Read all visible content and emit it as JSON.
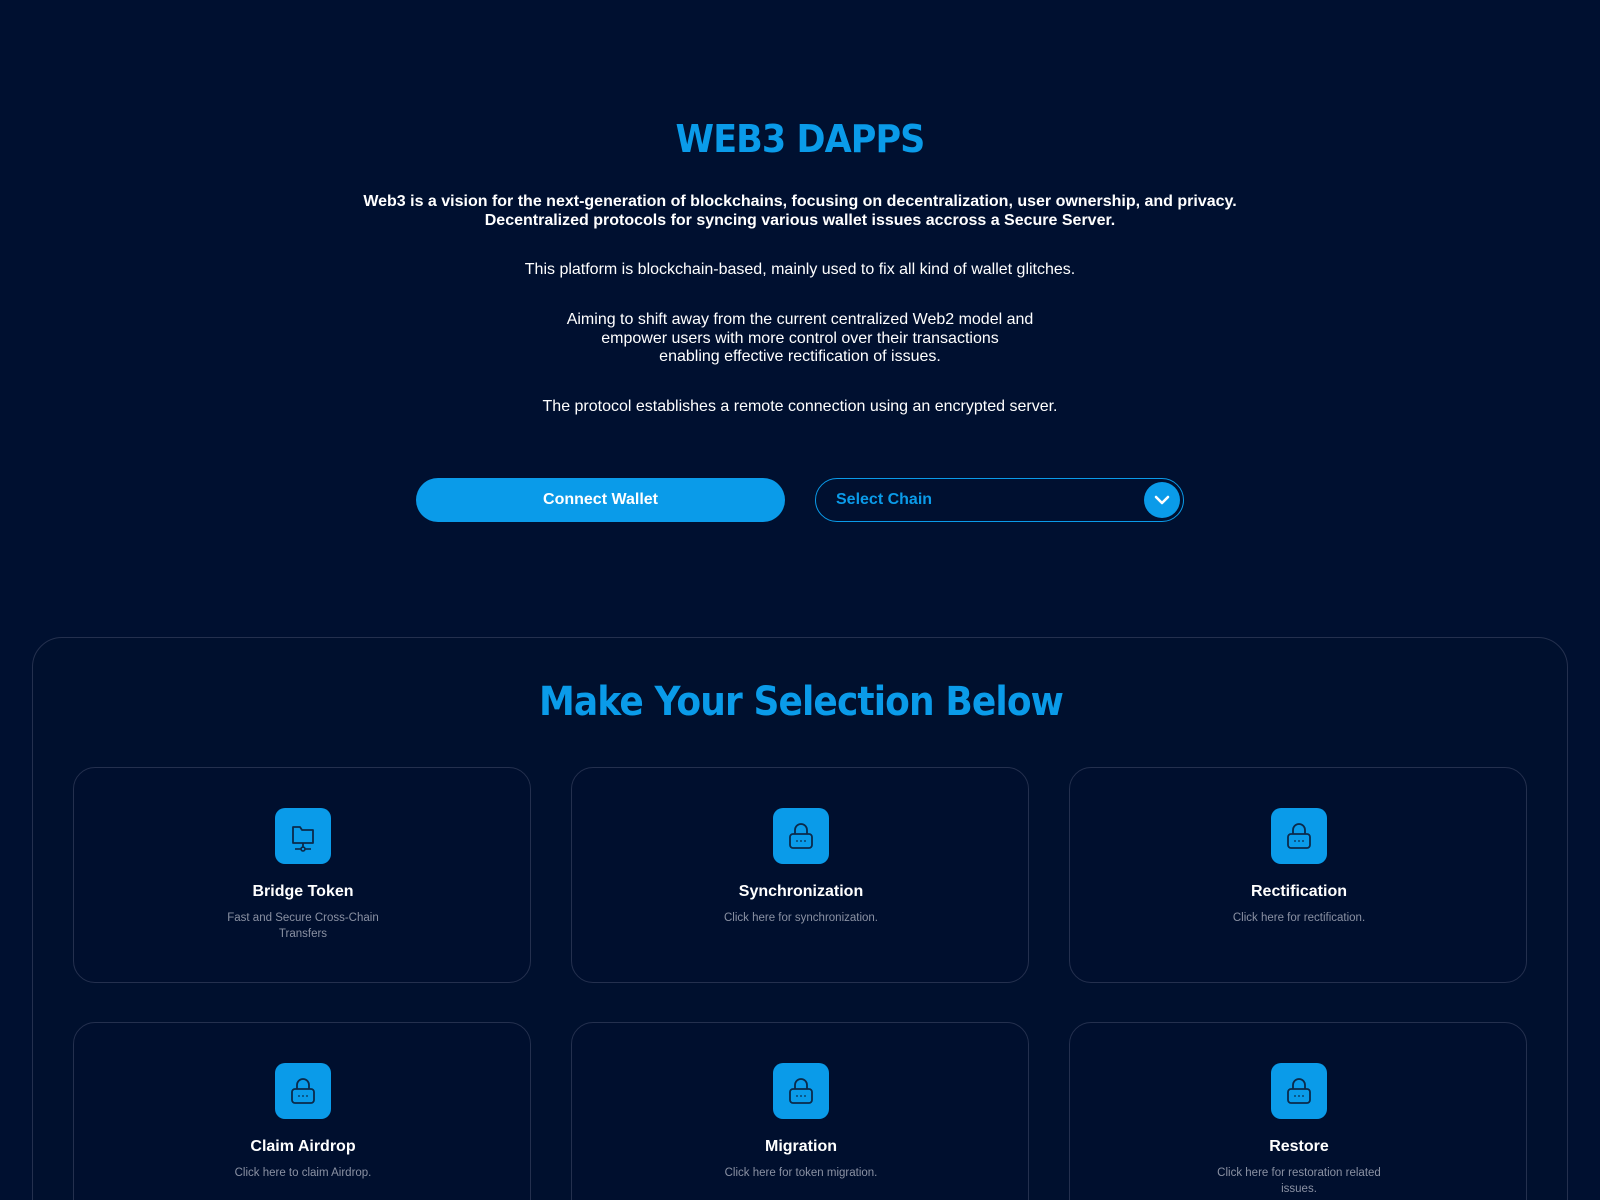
{
  "hero": {
    "title": "WEB3 DAPPS",
    "lead_line1": "Web3 is a vision for the next-generation of blockchains, focusing on decentralization, user ownership, and privacy.",
    "lead_line2": "Decentralized protocols for syncing various wallet issues accross a Secure Server.",
    "paragraph1": "This platform is blockchain-based, mainly used to fix all kind of wallet glitches.",
    "paragraph2_line1": "Aiming to shift away from the current centralized Web2 model and",
    "paragraph2_line2": "empower users with more control over their transactions",
    "paragraph2_line3": "enabling effective rectification of issues.",
    "paragraph3": "The protocol establishes a remote connection using an encrypted server."
  },
  "actions": {
    "connect_wallet_label": "Connect Wallet",
    "select_chain_label": "Select Chain",
    "select_chain_icon": "chevron-down-icon"
  },
  "selection": {
    "title": "Make Your Selection Below",
    "cards": [
      {
        "title": "Bridge Token",
        "description": "Fast and Secure Cross-Chain Transfers",
        "icon": "folder-network-icon"
      },
      {
        "title": "Synchronization",
        "description": "Click here for synchronization.",
        "icon": "lock-icon"
      },
      {
        "title": "Rectification",
        "description": "Click here for rectification.",
        "icon": "lock-icon"
      },
      {
        "title": "Claim Airdrop",
        "description": "Click here to claim Airdrop.",
        "icon": "lock-icon"
      },
      {
        "title": "Migration",
        "description": "Click here for token migration.",
        "icon": "lock-icon"
      },
      {
        "title": "Restore",
        "description": "Click here for restoration related issues.",
        "icon": "lock-icon"
      }
    ]
  },
  "colors": {
    "background": "#001030",
    "accent": "#0a9be9",
    "card_border": "#24304e",
    "muted_text": "#8a91a3"
  }
}
